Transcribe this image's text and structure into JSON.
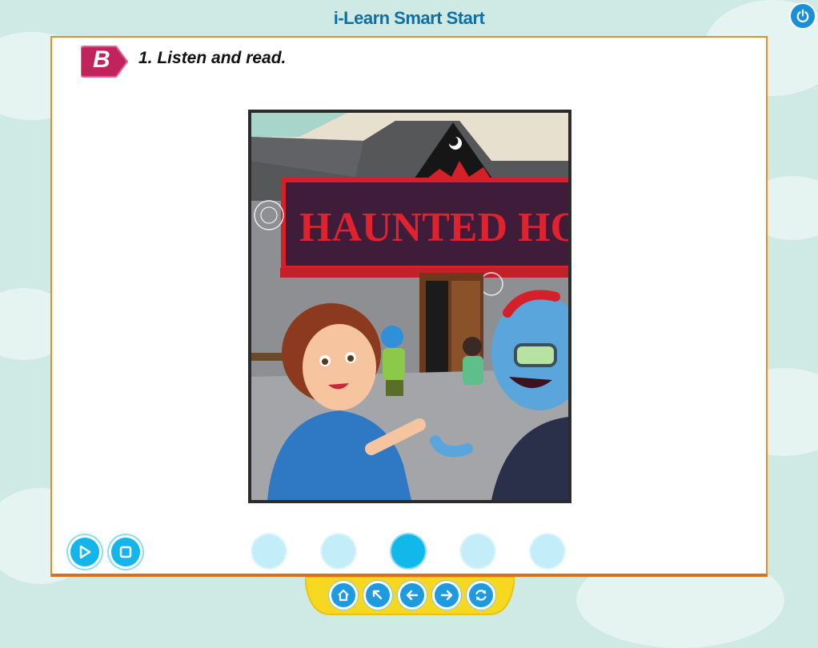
{
  "app": {
    "title": "i-Learn Smart Start"
  },
  "header": {
    "power_icon": "power-icon"
  },
  "activity": {
    "section_letter": "B",
    "instruction": "1. Listen and read.",
    "image": {
      "sign_text": "HAUNTED HOUSE",
      "description_icon": "illustration"
    }
  },
  "controls": {
    "play_icon": "play-icon",
    "stop_icon": "stop-icon",
    "pages": [
      {
        "label": "",
        "active": false
      },
      {
        "label": "",
        "active": false
      },
      {
        "label": "",
        "active": true
      },
      {
        "label": "",
        "active": false
      },
      {
        "label": "",
        "active": false
      }
    ]
  },
  "navigation": {
    "buttons": [
      "home-icon",
      "back-up-icon",
      "arrow-left-icon",
      "arrow-right-icon",
      "refresh-icon"
    ]
  },
  "colors": {
    "accent": "#13b5ea",
    "panel_border": "#f08a24",
    "title": "#0e6fa3",
    "badge": "#c0245a",
    "nav_bar": "#f6d820"
  }
}
